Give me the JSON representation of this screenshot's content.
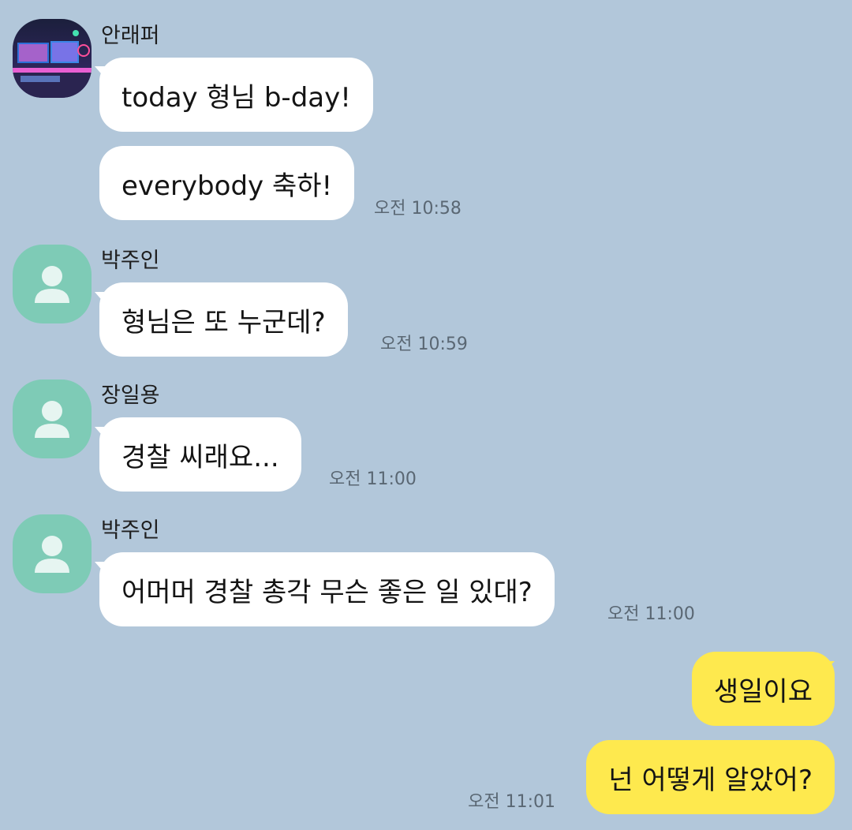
{
  "messages": [
    {
      "sender": "안래퍼",
      "texts": [
        "today 형님 b-day!",
        "everybody 축하!"
      ],
      "time": "오전 10:58"
    },
    {
      "sender": "박주인",
      "texts": [
        "형님은 또 누군데?"
      ],
      "time": "오전 10:59"
    },
    {
      "sender": "장일용",
      "texts": [
        "경찰 씨래요..."
      ],
      "time": "오전 11:00"
    },
    {
      "sender": "박주인",
      "texts": [
        "어머머 경찰 총각 무슨 좋은 일 있대?"
      ],
      "time": "오전 11:00"
    }
  ],
  "outgoing": {
    "texts": [
      "생일이요",
      "넌 어떻게 알았어?"
    ],
    "time": "오전 11:01"
  },
  "colors": {
    "background": "#b2c7da",
    "incoming_bubble": "#ffffff",
    "outgoing_bubble": "#fee94e",
    "default_avatar": "#7ecbb6"
  }
}
